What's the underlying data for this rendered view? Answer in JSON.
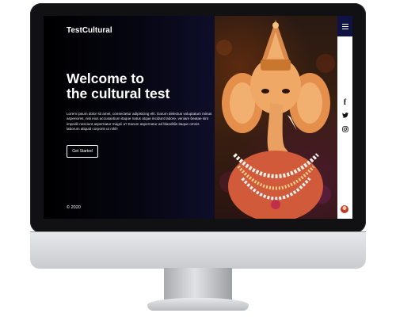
{
  "site": {
    "brand": "TestCultural",
    "hero": {
      "title_line1": "Welcome to",
      "title_line2": "the cultural test",
      "body": "Lorem ipsum dolor sit amet, consectetur adipisicing elit. Earum delectus voluptatum minus asperiores, nisi eius accusantium itaque natus atque incidunt labore, veniam beatae sint impedit nesciunt aspernatur magni a? Earum aspernatur ad blanditiis itaque omnis laborum aliquid corporis ut nihil!",
      "cta_label": "Get Started"
    },
    "footer": {
      "copyright": "© 2020"
    },
    "sidebar": {
      "menu_icon": "hamburger-icon",
      "social": [
        "facebook-icon",
        "twitter-icon",
        "instagram-icon"
      ],
      "avatar": "user-avatar"
    },
    "colors": {
      "menu_bg": "#0f1244",
      "hero_bg": "#000000",
      "text": "#ffffff"
    }
  }
}
